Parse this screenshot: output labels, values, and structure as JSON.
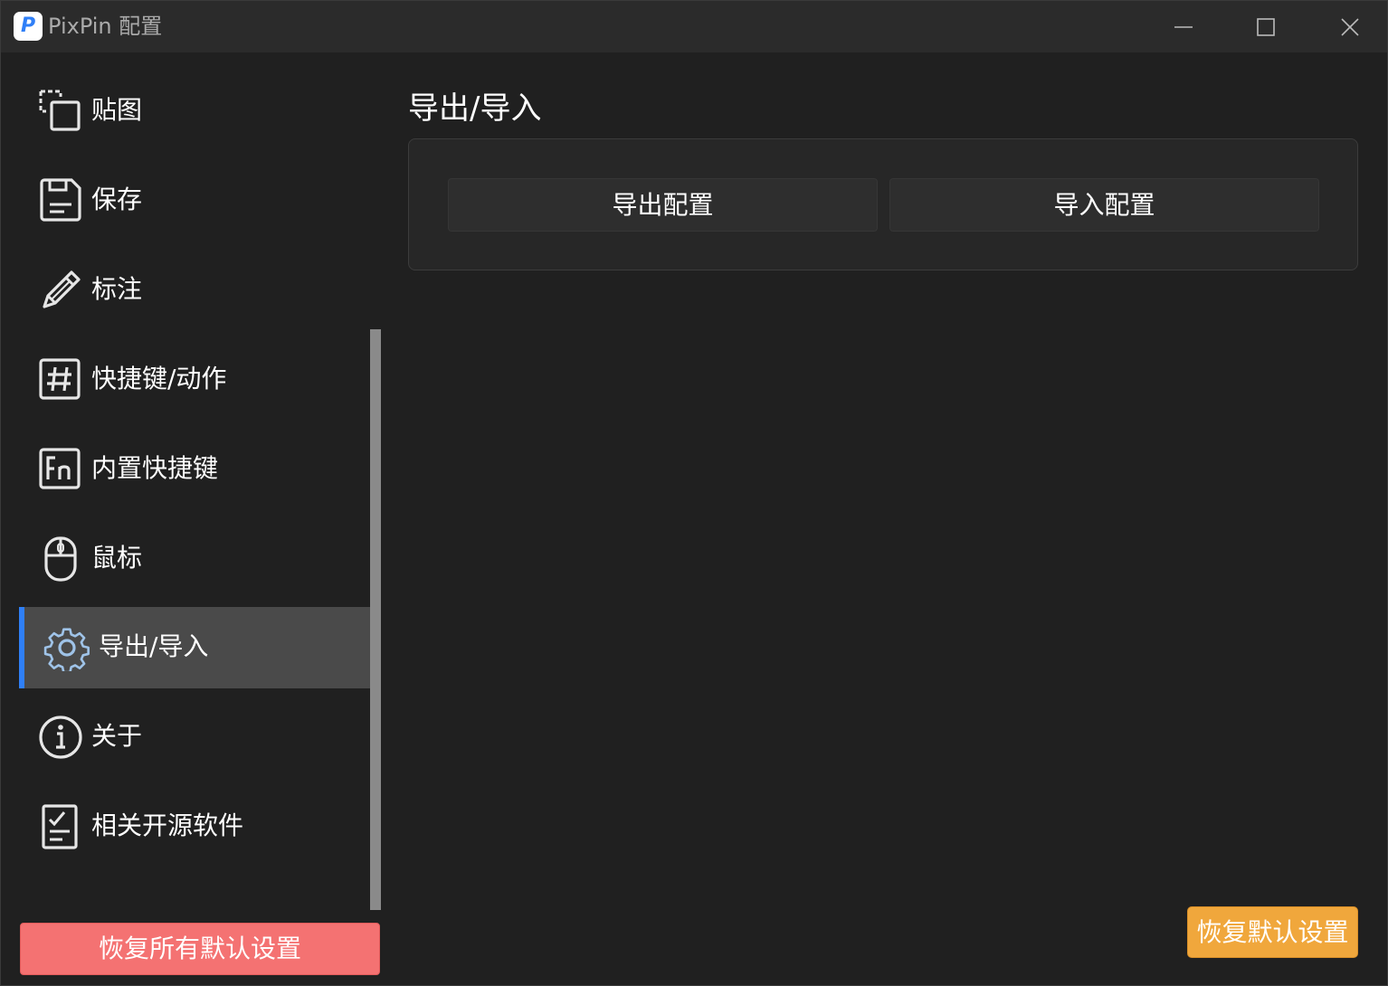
{
  "window": {
    "title": "PixPin 配置",
    "app_icon_letter": "P",
    "controls": [
      "minimize-icon",
      "maximize-icon",
      "close-icon"
    ]
  },
  "sidebar": {
    "items": [
      {
        "label": "贴图",
        "icon": "pin-image-icon",
        "active": false
      },
      {
        "label": "保存",
        "icon": "save-icon",
        "active": false
      },
      {
        "label": "标注",
        "icon": "pencil-icon",
        "active": false
      },
      {
        "label": "快捷键/动作",
        "icon": "hash-icon",
        "active": false
      },
      {
        "label": "内置快捷键",
        "icon": "fn-key-icon",
        "active": false
      },
      {
        "label": "鼠标",
        "icon": "mouse-icon",
        "active": false
      },
      {
        "label": "导出/导入",
        "icon": "gear-icon",
        "active": true
      },
      {
        "label": "关于",
        "icon": "info-icon",
        "active": false
      },
      {
        "label": "相关开源软件",
        "icon": "checklist-icon",
        "active": false
      }
    ],
    "reset_all_label": "恢复所有默认设置"
  },
  "main": {
    "title": "导出/导入",
    "export_label": "导出配置",
    "import_label": "导入配置",
    "reset_default_label": "恢复默认设置"
  },
  "colors": {
    "accent": "#2f7ff7",
    "reset_all": "#f47272",
    "reset_default": "#f0a73c",
    "active_gear": "#9fc3e8"
  }
}
